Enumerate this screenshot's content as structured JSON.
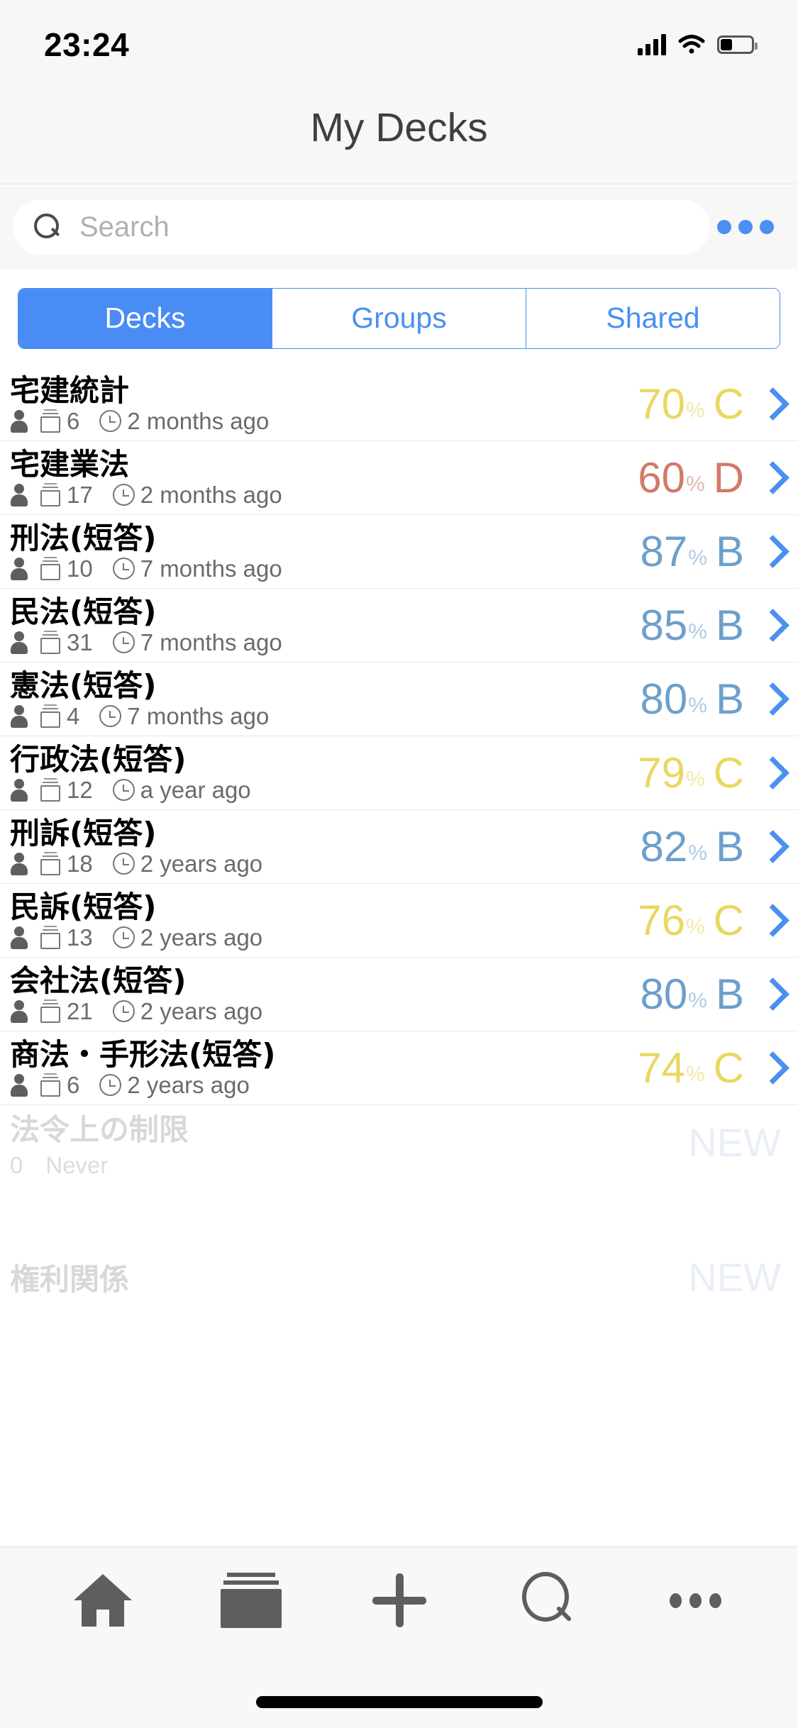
{
  "status_bar": {
    "time": "23:24",
    "signal_icon": "cellular-signal-icon",
    "wifi_icon": "wifi-icon",
    "battery_icon": "battery-icon"
  },
  "nav": {
    "title": "My Decks"
  },
  "search": {
    "placeholder": "Search",
    "value": "",
    "icon": "search-icon",
    "more_icon": "more-horizontal-icon"
  },
  "tabs": [
    {
      "label": "Decks",
      "active": true
    },
    {
      "label": "Groups",
      "active": false
    },
    {
      "label": "Shared",
      "active": false
    }
  ],
  "colors": {
    "accent_blue": "#4a90f0",
    "tab_active_bg": "#4a8cf5",
    "grade_b": "#6d9fcc",
    "grade_c": "#e8d860",
    "grade_d": "#d07b68",
    "meta_text": "#6b6b6b",
    "toolbar_icon": "#5e5e5e"
  },
  "decks": [
    {
      "title": "宅建統計",
      "owner_icon": "person-icon",
      "cards_icon": "card-stack-icon",
      "cards": "6",
      "time_icon": "clock-icon",
      "updated": "2 months ago",
      "score": "70",
      "percent": "%",
      "grade": "C",
      "grade_color": "#e8d860",
      "chevron_icon": "chevron-right-icon"
    },
    {
      "title": "宅建業法",
      "owner_icon": "person-icon",
      "cards_icon": "card-stack-icon",
      "cards": "17",
      "time_icon": "clock-icon",
      "updated": "2 months ago",
      "score": "60",
      "percent": "%",
      "grade": "D",
      "grade_color": "#d07b68",
      "chevron_icon": "chevron-right-icon"
    },
    {
      "title": "刑法(短答)",
      "owner_icon": "person-icon",
      "cards_icon": "card-stack-icon",
      "cards": "10",
      "time_icon": "clock-icon",
      "updated": "7 months ago",
      "score": "87",
      "percent": "%",
      "grade": "B",
      "grade_color": "#6d9fcc",
      "chevron_icon": "chevron-right-icon"
    },
    {
      "title": "民法(短答)",
      "owner_icon": "person-icon",
      "cards_icon": "card-stack-icon",
      "cards": "31",
      "time_icon": "clock-icon",
      "updated": "7 months ago",
      "score": "85",
      "percent": "%",
      "grade": "B",
      "grade_color": "#6d9fcc",
      "chevron_icon": "chevron-right-icon"
    },
    {
      "title": "憲法(短答)",
      "owner_icon": "person-icon",
      "cards_icon": "card-stack-icon",
      "cards": "4",
      "time_icon": "clock-icon",
      "updated": "7 months ago",
      "score": "80",
      "percent": "%",
      "grade": "B",
      "grade_color": "#6d9fcc",
      "chevron_icon": "chevron-right-icon"
    },
    {
      "title": "行政法(短答)",
      "owner_icon": "person-icon",
      "cards_icon": "card-stack-icon",
      "cards": "12",
      "time_icon": "clock-icon",
      "updated": "a year ago",
      "score": "79",
      "percent": "%",
      "grade": "C",
      "grade_color": "#e8d860",
      "chevron_icon": "chevron-right-icon"
    },
    {
      "title": "刑訴(短答)",
      "owner_icon": "person-icon",
      "cards_icon": "card-stack-icon",
      "cards": "18",
      "time_icon": "clock-icon",
      "updated": "2 years ago",
      "score": "82",
      "percent": "%",
      "grade": "B",
      "grade_color": "#6d9fcc",
      "chevron_icon": "chevron-right-icon"
    },
    {
      "title": "民訴(短答)",
      "owner_icon": "person-icon",
      "cards_icon": "card-stack-icon",
      "cards": "13",
      "time_icon": "clock-icon",
      "updated": "2 years ago",
      "score": "76",
      "percent": "%",
      "grade": "C",
      "grade_color": "#e8d860",
      "chevron_icon": "chevron-right-icon"
    },
    {
      "title": "会社法(短答)",
      "owner_icon": "person-icon",
      "cards_icon": "card-stack-icon",
      "cards": "21",
      "time_icon": "clock-icon",
      "updated": "2 years ago",
      "score": "80",
      "percent": "%",
      "grade": "B",
      "grade_color": "#6d9fcc",
      "chevron_icon": "chevron-right-icon"
    },
    {
      "title": "商法・手形法(短答)",
      "owner_icon": "person-icon",
      "cards_icon": "card-stack-icon",
      "cards": "6",
      "time_icon": "clock-icon",
      "updated": "2 years ago",
      "score": "74",
      "percent": "%",
      "grade": "C",
      "grade_color": "#e8d860",
      "chevron_icon": "chevron-right-icon"
    }
  ],
  "obscured_rows": [
    {
      "title": "法令上の制限",
      "cards": "0",
      "updated": "Never",
      "grade": "NEW"
    },
    {
      "title": "権利関係",
      "cards": "",
      "updated": "",
      "grade": "NEW"
    }
  ],
  "toolbar": [
    {
      "label": "Home",
      "icon": "home-icon"
    },
    {
      "label": "Decks",
      "icon": "card-stack-icon"
    },
    {
      "label": "Add",
      "icon": "plus-icon"
    },
    {
      "label": "Search",
      "icon": "search-icon"
    },
    {
      "label": "More",
      "icon": "more-horizontal-icon"
    }
  ]
}
